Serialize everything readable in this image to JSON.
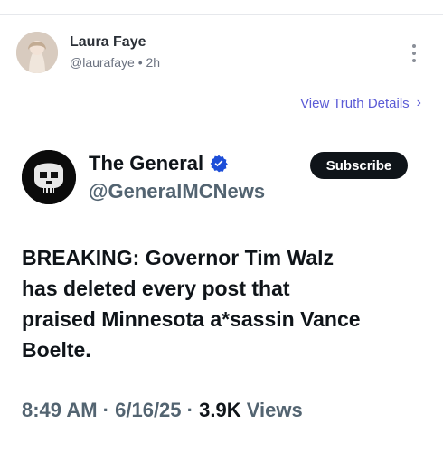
{
  "post": {
    "author_name": "Laura Faye",
    "handle": "@laurafaye",
    "separator": "•",
    "time": "2h"
  },
  "actions": {
    "view_truth_details": "View Truth Details",
    "chevron": "›"
  },
  "embedded": {
    "name": "The General",
    "handle": "@GeneralMCNews",
    "subscribe_label": "Subscribe",
    "text_lines": [
      "BREAKING: Governor Tim Walz",
      "has deleted every post that",
      "praised Minnesota a*sassin Vance",
      "Boelte."
    ],
    "meta": {
      "time": "8:49 AM",
      "dot1": "·",
      "date": "6/16/25",
      "dot2": "·",
      "views_count": "3.9K",
      "views_label": "Views"
    }
  },
  "colors": {
    "link": "#5b5bd6",
    "verified": "#1d4ed8",
    "text": "#0f1419",
    "muted": "#536471"
  },
  "icons": {
    "more": "kebab-icon",
    "chevron": "chevron-right-icon",
    "verified": "verified-badge-icon"
  }
}
